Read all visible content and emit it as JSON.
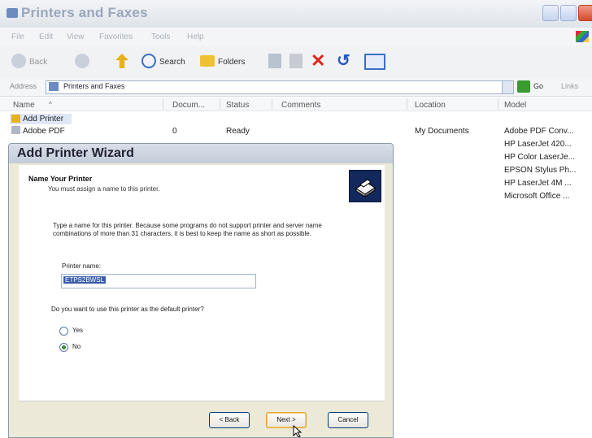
{
  "window": {
    "title": "Printers and Faxes"
  },
  "menu": [
    "File",
    "Edit",
    "View",
    "Favorites",
    "Tools",
    "Help"
  ],
  "toolbar": {
    "back": "Back",
    "search": "Search",
    "folders": "Folders"
  },
  "address": {
    "label": "Address",
    "value": "Printers and Faxes",
    "go": "Go",
    "links": "Links"
  },
  "columns": [
    "Name",
    "Docum...",
    "Status",
    "Comments",
    "Location",
    "Model"
  ],
  "rows": {
    "add_printer": "Add Printer",
    "adobe": {
      "name": "Adobe PDF",
      "docs": "0",
      "status": "Ready",
      "location": "My Documents",
      "model": "Adobe PDF Conv..."
    }
  },
  "models": [
    "HP LaserJet 420...",
    "HP Color LaserJe...",
    "EPSON Stylus Ph...",
    "HP LaserJet 4M ...",
    "Microsoft Office ..."
  ],
  "wizard": {
    "title": "Add Printer Wizard",
    "heading": "Name Your Printer",
    "subheading": "You must assign a name to this printer.",
    "description": "Type a name for this printer. Because some programs do not support printer and server name combinations of more than 31 characters, it is best to keep the name as short as possible.",
    "printer_name_label": "Printer name:",
    "printer_name_value": "ETPS2BWSL",
    "default_question": "Do you want to use this printer as the default printer?",
    "yes": "Yes",
    "no": "No",
    "selected": "No",
    "back": "< Back",
    "next": "Next >",
    "cancel": "Cancel"
  }
}
